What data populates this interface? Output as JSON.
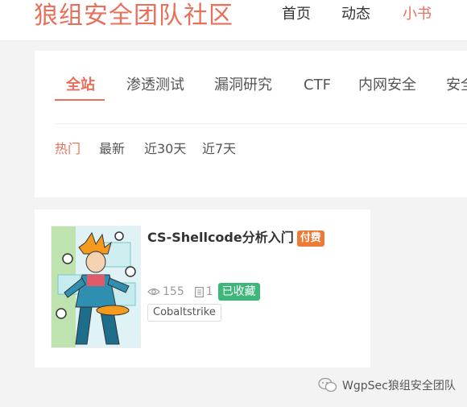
{
  "header": {
    "site_title": "狼组安全团队社区",
    "nav": [
      {
        "label": "首页",
        "active": false
      },
      {
        "label": "动态",
        "active": false
      },
      {
        "label": "小书",
        "active": true
      }
    ]
  },
  "categories": [
    "全站",
    "渗透测试",
    "漏洞研究",
    "CTF",
    "内网安全",
    "安全"
  ],
  "active_category": "全站",
  "sort_tabs": [
    "热门",
    "最新",
    "近30天",
    "近7天"
  ],
  "active_sort": "热门",
  "post": {
    "title": "CS-Shellcode分析入门",
    "paid_label": "付费",
    "views": "155",
    "chapters": "1",
    "collected_label": "已收藏",
    "tag": "Cobaltstrike"
  },
  "watermark": "WgpSec狼组安全团队",
  "colors": {
    "accent": "#ea6f5a",
    "paid": "#ee7a36",
    "collected": "#3db87a"
  }
}
